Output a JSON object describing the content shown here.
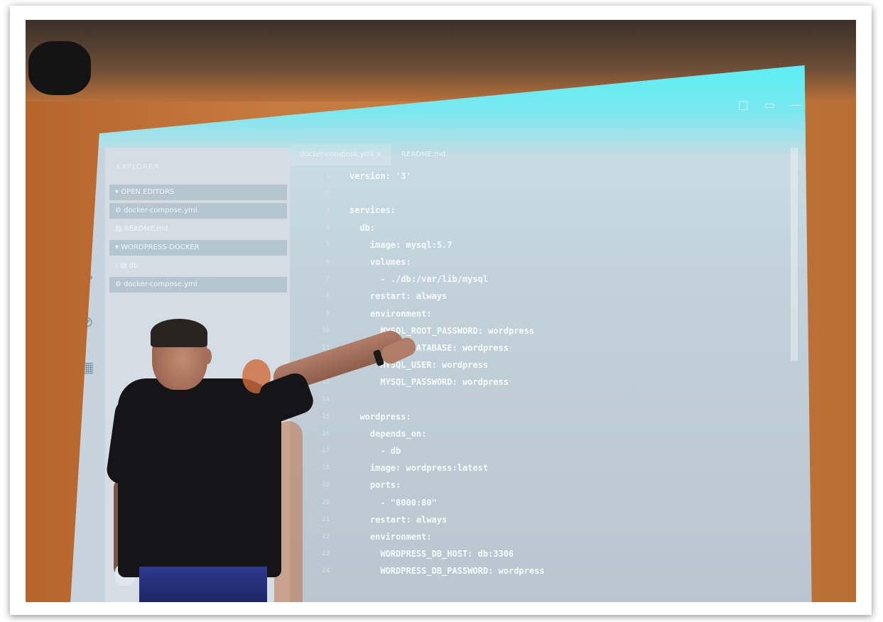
{
  "colors": {
    "wall": "#c47a3c",
    "screen_accent": "#4ff0f6",
    "shirt": "#151518",
    "shorts": "#2e3a8f"
  },
  "titlebar": {
    "controls": [
      "□",
      "▭",
      "—"
    ]
  },
  "activity_bar": {
    "icons": [
      "files-icon",
      "search-icon",
      "git-icon",
      "debug-icon",
      "extensions-icon"
    ]
  },
  "sidebar": {
    "title": "EXPLORER",
    "rows": [
      {
        "text": "▾ OPEN EDITORS",
        "selected": true
      },
      {
        "text": "⚙ docker-compose.yml",
        "selected": true
      },
      {
        "text": "▤ README.md",
        "selected": false
      },
      {
        "text": "▾ WORDPRESS-DOCKER",
        "selected": true
      },
      {
        "text": "› ▤ db",
        "selected": false
      },
      {
        "text": "⚙ docker-compose.yml",
        "selected": true
      }
    ]
  },
  "tabs": [
    {
      "label": "docker-compose.yml ×",
      "active": true
    },
    {
      "label": "README.md",
      "active": false
    }
  ],
  "code": [
    {
      "n": "1",
      "text": "version: '3'"
    },
    {
      "n": "2",
      "text": ""
    },
    {
      "n": "3",
      "text": "services:"
    },
    {
      "n": "4",
      "text": "  db:"
    },
    {
      "n": "5",
      "text": "    image: mysql:5.7"
    },
    {
      "n": "6",
      "text": "    volumes:"
    },
    {
      "n": "7",
      "text": "      - ./db:/var/lib/mysql"
    },
    {
      "n": "8",
      "text": "    restart: always"
    },
    {
      "n": "9",
      "text": "    environment:"
    },
    {
      "n": "10",
      "text": "      MYSQL_ROOT_PASSWORD: wordpress"
    },
    {
      "n": "11",
      "text": "      MYSQL_DATABASE: wordpress"
    },
    {
      "n": "12",
      "text": "      MYSQL_USER: wordpress"
    },
    {
      "n": "13",
      "text": "      MYSQL_PASSWORD: wordpress"
    },
    {
      "n": "14",
      "text": ""
    },
    {
      "n": "15",
      "text": "  wordpress:"
    },
    {
      "n": "16",
      "text": "    depends_on:"
    },
    {
      "n": "17",
      "text": "      - db"
    },
    {
      "n": "18",
      "text": "    image: wordpress:latest"
    },
    {
      "n": "19",
      "text": "    ports:"
    },
    {
      "n": "20",
      "text": "      - \"8000:80\""
    },
    {
      "n": "21",
      "text": "    restart: always"
    },
    {
      "n": "22",
      "text": "    environment:"
    },
    {
      "n": "23",
      "text": "      WORDPRESS_DB_HOST: db:3306"
    },
    {
      "n": "24",
      "text": "      WORDPRESS_DB_PASSWORD: wordpress"
    }
  ]
}
